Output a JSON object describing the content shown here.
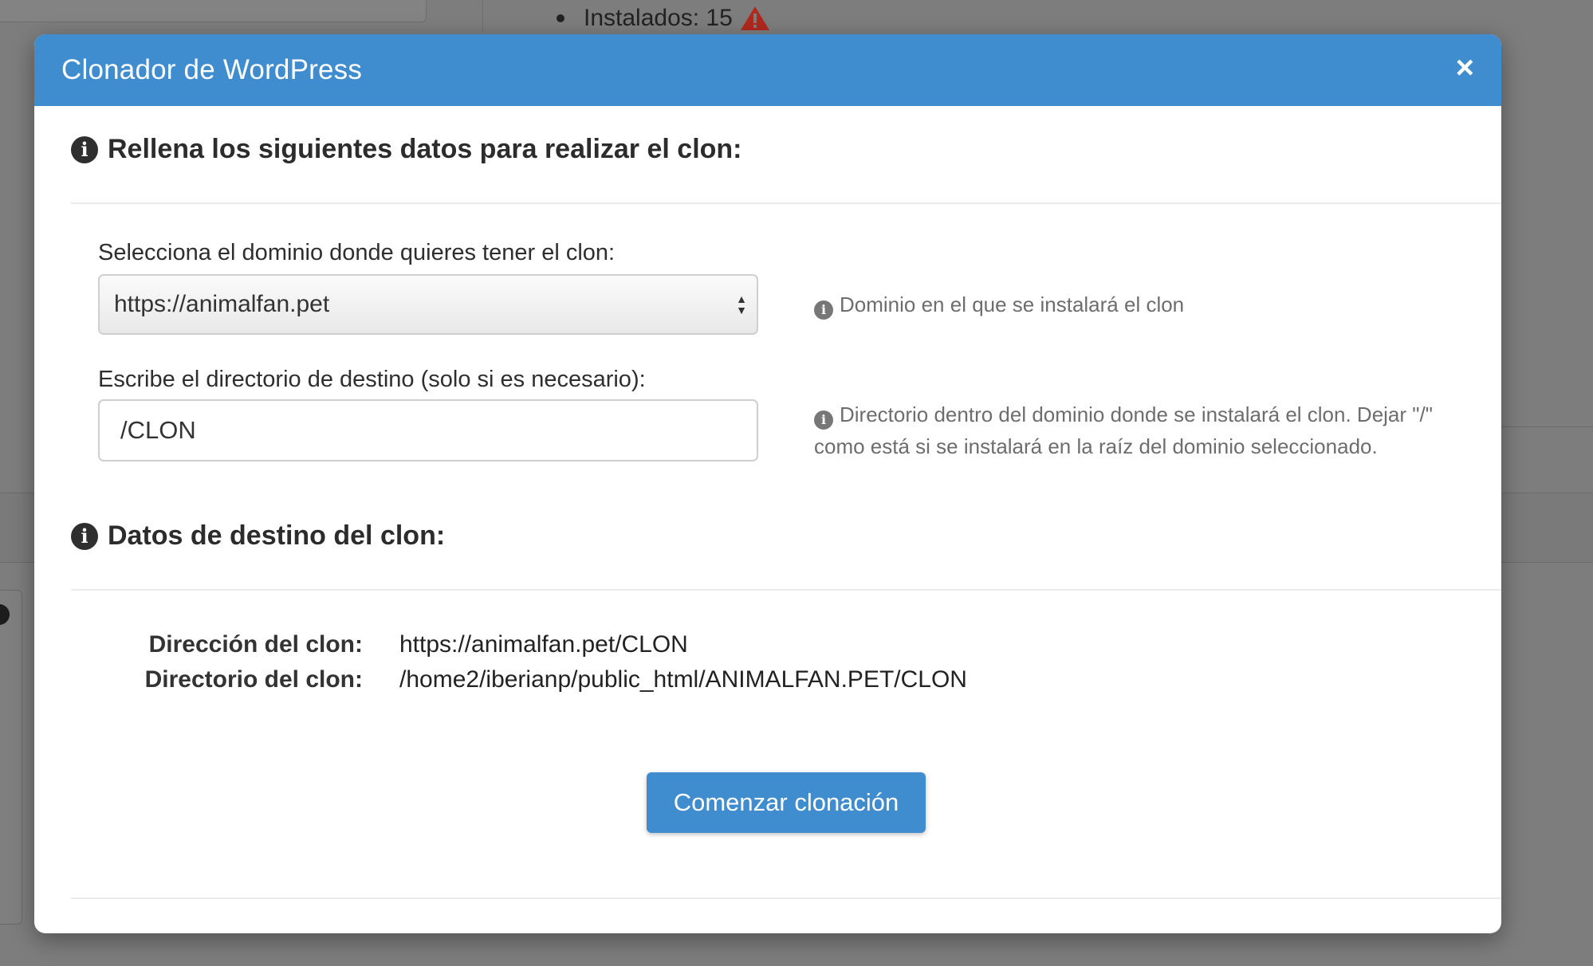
{
  "background": {
    "list_item": "Instalados: 15"
  },
  "modal": {
    "title": "Clonador de WordPress",
    "close_glyph": "×",
    "section1_title": "Rellena los siguientes datos para realizar el clon:",
    "domain_label": "Selecciona el dominio donde quieres tener el clon:",
    "domain_selected": "https://animalfan.pet",
    "domain_help": "Dominio en el que se instalará el clon",
    "directory_label": "Escribe el directorio de destino (solo si es necesario):",
    "directory_value": "/CLON",
    "directory_help": "Directorio dentro del dominio donde se instalará el clon. Dejar \"/\" como está si se instalará en la raíz del dominio seleccionado.",
    "section2_title": "Datos de destino del clon:",
    "address_key": "Dirección del clon:",
    "address_value": "https://animalfan.pet/CLON",
    "dir_key": "Directorio del clon:",
    "dir_value": "/home2/iberianp/public_html/ANIMALFAN.PET/CLON",
    "start_button": "Comenzar clonación"
  },
  "icons": {
    "info": "info-circle-icon",
    "warning": "warning-triangle-icon",
    "close": "close-icon",
    "select_arrows": "select-arrows-icon"
  },
  "colors": {
    "accent": "#3f8ccf",
    "overlay": "#7d7d7d",
    "warning": "#c0392b"
  }
}
